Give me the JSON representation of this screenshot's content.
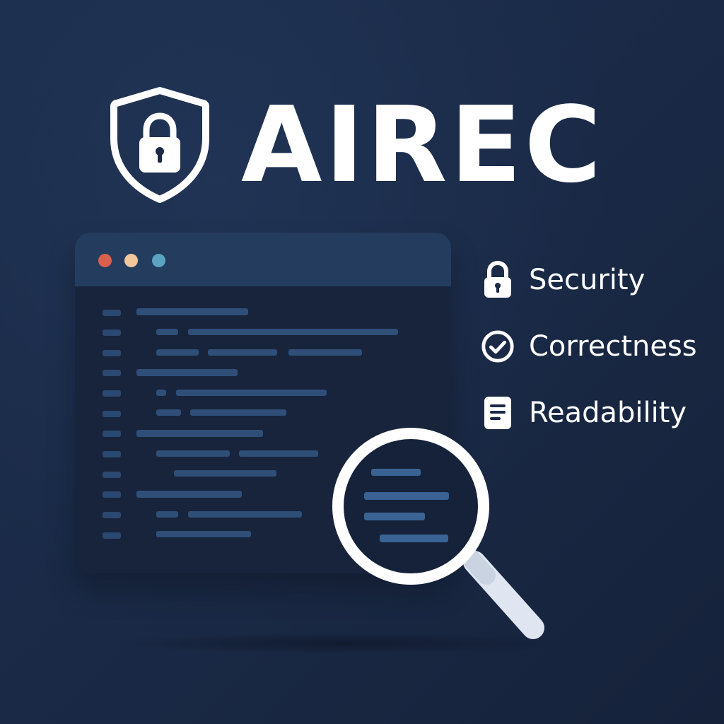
{
  "brand": {
    "title": "AIREC",
    "logo_icon": "shield-lock-icon"
  },
  "features": [
    {
      "label": "Security",
      "icon": "lock-icon"
    },
    {
      "label": "Correctness",
      "icon": "check-circle-icon"
    },
    {
      "label": "Readability",
      "icon": "document-icon"
    }
  ],
  "code_window": {
    "window_controls": [
      "close-dot",
      "minimize-dot",
      "maximize-dot"
    ],
    "magnifier_icon": "magnifying-glass-icon"
  },
  "colors": {
    "background": "#1b2a46",
    "titlebar": "#243d5f",
    "code_line": "#2f4f79",
    "dot_red": "#d9604f",
    "dot_yellow": "#f1c79c",
    "dot_blue": "#5aa3c1",
    "text": "#ffffff"
  }
}
